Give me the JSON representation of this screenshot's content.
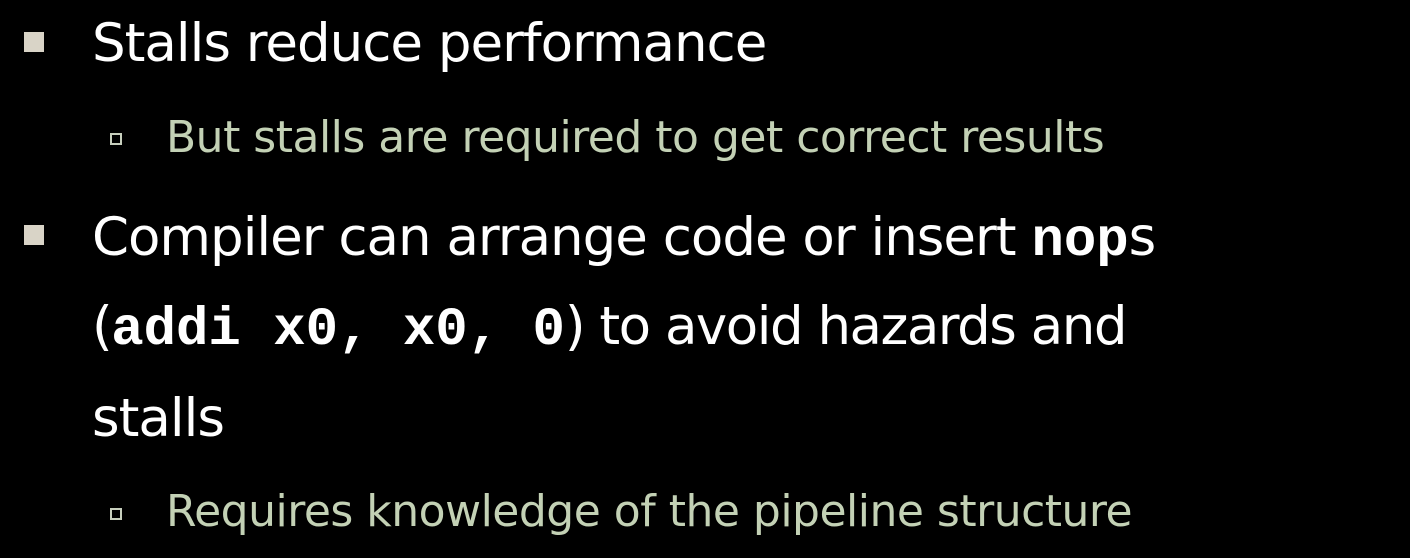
{
  "slide": {
    "bullets": [
      {
        "level": 1,
        "text": "Stalls reduce performance",
        "sub": [
          {
            "level": 2,
            "text": "But stalls are required to get correct results"
          }
        ]
      },
      {
        "level": 1,
        "line1": {
          "text": "Compiler can arrange code or insert ",
          "code": "nop",
          "suffix": "s"
        },
        "line2": {
          "paren_open": "(",
          "code": "addi x0, x0, 0",
          "suffix": ") to avoid hazards and"
        },
        "line3": {
          "text": "stalls"
        },
        "sub": [
          {
            "level": 2,
            "text": "Requires knowledge of the pipeline structure"
          }
        ]
      }
    ],
    "colors": {
      "background": "#000000",
      "level1_text": "#ffffff",
      "level2_text": "#c3d1b5",
      "level1_bullet": "#d9d4c7",
      "level2_bullet": "#c7cfbd"
    }
  }
}
